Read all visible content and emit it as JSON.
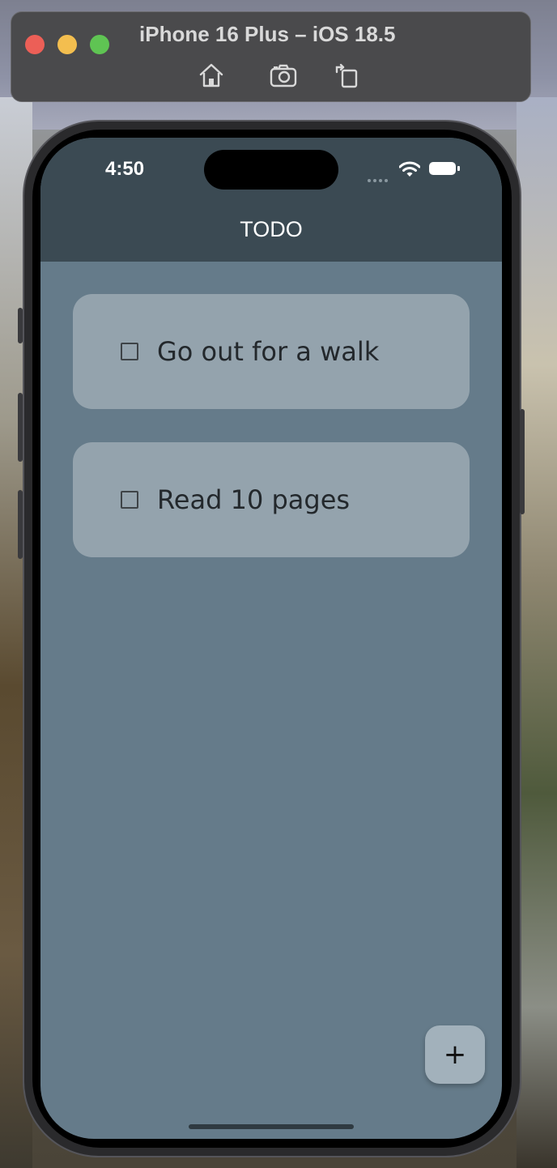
{
  "simulator": {
    "title": "iPhone 16 Plus – iOS 18.5",
    "toolbar": [
      "home-icon",
      "screenshot-icon",
      "rotate-icon"
    ]
  },
  "status_bar": {
    "time": "4:50"
  },
  "app_bar": {
    "title": "TODO"
  },
  "todos": [
    {
      "label": "Go out for a walk",
      "checked": false
    },
    {
      "label": "Read 10 pages",
      "checked": false
    }
  ],
  "fab": {
    "icon": "plus-icon",
    "symbol": "+"
  },
  "colors": {
    "app_bar": "#3b4a53",
    "background": "#657b8a",
    "card": "#94a3ad",
    "fab": "#a2b1bb"
  }
}
